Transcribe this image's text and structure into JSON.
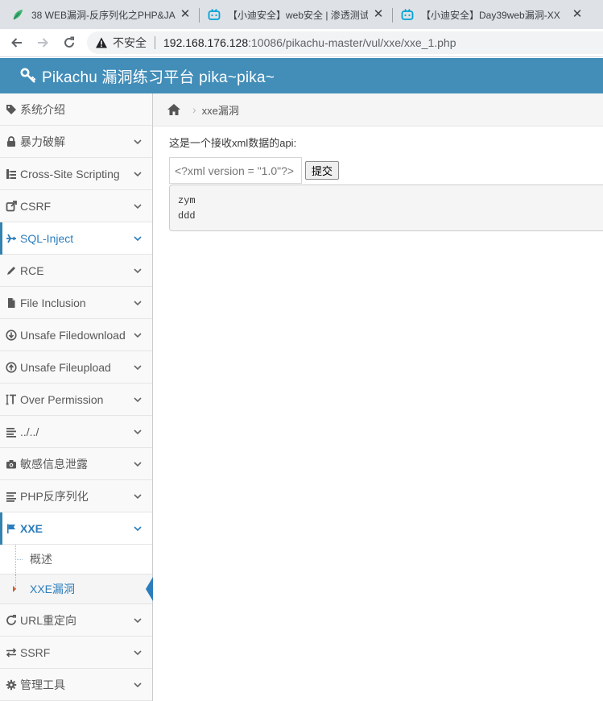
{
  "browser": {
    "tabs": [
      {
        "title": "38 WEB漏洞-反序列化之PHP&JA",
        "favicon": "leaf-icon"
      },
      {
        "title": "【小迪安全】web安全 | 渗透测试",
        "favicon": "bilibili-icon"
      },
      {
        "title": "【小迪安全】Day39web漏洞-XX",
        "favicon": "bilibili-icon"
      }
    ],
    "insecure_label": "不安全",
    "url_host": "192.168.176.128",
    "url_rest": ":10086/pikachu-master/vul/xxe/xxe_1.php"
  },
  "header": {
    "brand": "Pikachu 漏洞练习平台 pika~pika~"
  },
  "sidebar": {
    "items": [
      {
        "label": "系统介绍",
        "icon": "tag-icon"
      },
      {
        "label": "暴力破解",
        "icon": "lock-icon"
      },
      {
        "label": "Cross-Site Scripting",
        "icon": "sitemap-icon"
      },
      {
        "label": "CSRF",
        "icon": "external-link-icon"
      },
      {
        "label": "SQL-Inject",
        "icon": "plane-icon"
      },
      {
        "label": "RCE",
        "icon": "pencil-icon"
      },
      {
        "label": "File Inclusion",
        "icon": "file-icon"
      },
      {
        "label": "Unsafe Filedownload",
        "icon": "download-icon"
      },
      {
        "label": "Unsafe Fileupload",
        "icon": "upload-icon"
      },
      {
        "label": "Over Permission",
        "icon": "text-height-icon"
      },
      {
        "label": "../../",
        "icon": "align-left-icon"
      },
      {
        "label": "敏感信息泄露",
        "icon": "camera-icon"
      },
      {
        "label": "PHP反序列化",
        "icon": "list-icon"
      },
      {
        "label": "XXE",
        "icon": "flag-icon"
      },
      {
        "label": "URL重定向",
        "icon": "refresh-icon"
      },
      {
        "label": "SSRF",
        "icon": "exchange-icon"
      },
      {
        "label": "管理工具",
        "icon": "gear-icon"
      }
    ],
    "xxe_sub": [
      {
        "label": "概述"
      },
      {
        "label": "XXE漏洞"
      }
    ]
  },
  "breadcrumb": {
    "current": "xxe漏洞"
  },
  "main": {
    "intro": "这是一个接收xml数据的api:",
    "input_placeholder": "<?xml version = \"1.0\"?>",
    "submit_label": "提交",
    "result_lines": [
      "zym",
      "ddd"
    ]
  },
  "colors": {
    "header_bg": "#438eb9",
    "active_text": "#2b7dbc",
    "sidebar_bg": "#f9f9f9"
  }
}
